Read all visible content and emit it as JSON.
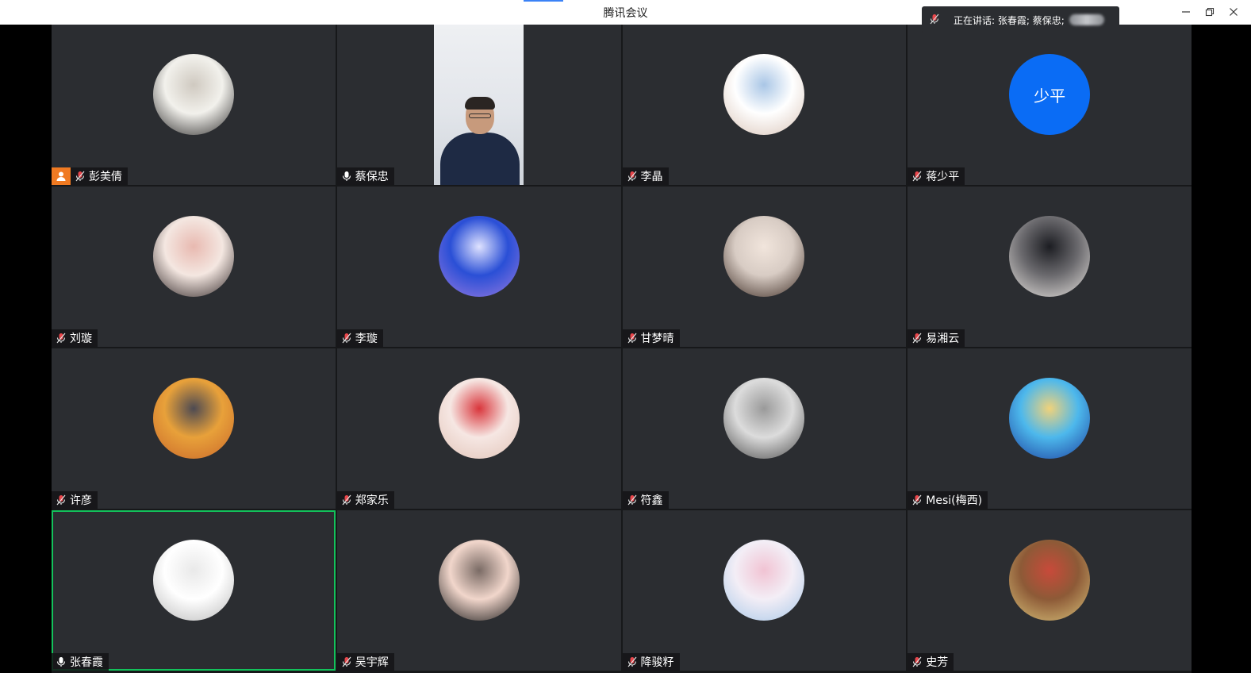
{
  "window": {
    "title": "腾讯会议",
    "controls": [
      "minimize",
      "restore",
      "close"
    ]
  },
  "speaking": {
    "text": "正在讲话: 张春霞; 蔡保忠;"
  },
  "colors": {
    "tile_bg": "#2b2d31",
    "active_border": "#13c15b",
    "muted_mic": "#e8464b",
    "host_badge": "#f07a22",
    "text_avatar": "#0a6cf5"
  },
  "participants": [
    {
      "name": "彭美倩",
      "mic": "muted",
      "host": true,
      "avatar_type": "photo",
      "avatar_icon": "person-photo-icon",
      "avatar_colors": [
        "#f2f1ec",
        "#2c2a2a",
        "#cfc9c0"
      ]
    },
    {
      "name": "蔡保忠",
      "mic": "on",
      "host": false,
      "avatar_type": "video",
      "avatar_icon": "camera-video-feed"
    },
    {
      "name": "李晶",
      "mic": "muted",
      "host": false,
      "avatar_type": "photo",
      "avatar_icon": "anime-girl-icon",
      "avatar_colors": [
        "#ffffff",
        "#d9c4b7",
        "#a9c6e6"
      ]
    },
    {
      "name": "蒋少平",
      "mic": "muted",
      "host": false,
      "avatar_type": "text",
      "avatar_text": "少平",
      "avatar_colors": [
        "#0a6cf5"
      ]
    },
    {
      "name": "刘璇",
      "mic": "muted",
      "host": false,
      "avatar_type": "photo",
      "avatar_icon": "person-photo-icon",
      "avatar_colors": [
        "#f4e7e1",
        "#2e2424",
        "#e8b9b0"
      ]
    },
    {
      "name": "李璇",
      "mic": "muted",
      "host": false,
      "avatar_type": "photo",
      "avatar_icon": "city-stairs-icon",
      "avatar_colors": [
        "#2a4fd6",
        "#9a7be0",
        "#dfe2ff"
      ]
    },
    {
      "name": "甘梦晴",
      "mic": "muted",
      "host": false,
      "avatar_type": "photo",
      "avatar_icon": "person-photo-icon",
      "avatar_colors": [
        "#d8ccc4",
        "#3b2a22",
        "#f1e5dc"
      ]
    },
    {
      "name": "易湘云",
      "mic": "muted",
      "host": false,
      "avatar_type": "photo",
      "avatar_icon": "group-photo-icon",
      "avatar_colors": [
        "#6b6a6e",
        "#e7e3df",
        "#1c1d22"
      ]
    },
    {
      "name": "许彦",
      "mic": "muted",
      "host": false,
      "avatar_type": "photo",
      "avatar_icon": "cartoon-icon",
      "avatar_colors": [
        "#e8a13a",
        "#c9672a",
        "#4d4a52"
      ]
    },
    {
      "name": "郑家乐",
      "mic": "muted",
      "host": false,
      "avatar_type": "photo",
      "avatar_icon": "baby-photo-icon",
      "avatar_colors": [
        "#f6e7e3",
        "#e1c3b7",
        "#d9363c"
      ]
    },
    {
      "name": "符鑫",
      "mic": "muted",
      "host": false,
      "avatar_type": "photo",
      "avatar_icon": "monochrome-photo-icon",
      "avatar_colors": [
        "#dcdcdc",
        "#4a4a4a",
        "#9a9a9a"
      ]
    },
    {
      "name": "Mesi(梅西)",
      "mic": "muted",
      "host": false,
      "avatar_type": "photo",
      "avatar_icon": "religious-art-icon",
      "avatar_colors": [
        "#4db8ec",
        "#1d3f9e",
        "#f0d27a"
      ]
    },
    {
      "name": "张春霞",
      "mic": "on",
      "host": false,
      "active": true,
      "avatar_type": "photo",
      "avatar_icon": "sketch-drawing-icon",
      "avatar_colors": [
        "#ffffff",
        "#b9b9b9",
        "#e9e9e9"
      ]
    },
    {
      "name": "吴宇辉",
      "mic": "muted",
      "host": false,
      "avatar_type": "photo",
      "avatar_icon": "child-glasses-icon",
      "avatar_colors": [
        "#f1d6cb",
        "#151515",
        "#7a6b65"
      ]
    },
    {
      "name": "降骏籽",
      "mic": "muted",
      "host": false,
      "avatar_type": "photo",
      "avatar_icon": "anime-girl-icon",
      "avatar_colors": [
        "#f3eef6",
        "#a8c8e8",
        "#f1c3d3"
      ]
    },
    {
      "name": "史芳",
      "mic": "muted",
      "host": false,
      "avatar_type": "photo",
      "avatar_icon": "rainbow-art-icon",
      "avatar_colors": [
        "#8d5a37",
        "#d8c27a",
        "#c84a3a"
      ]
    }
  ]
}
